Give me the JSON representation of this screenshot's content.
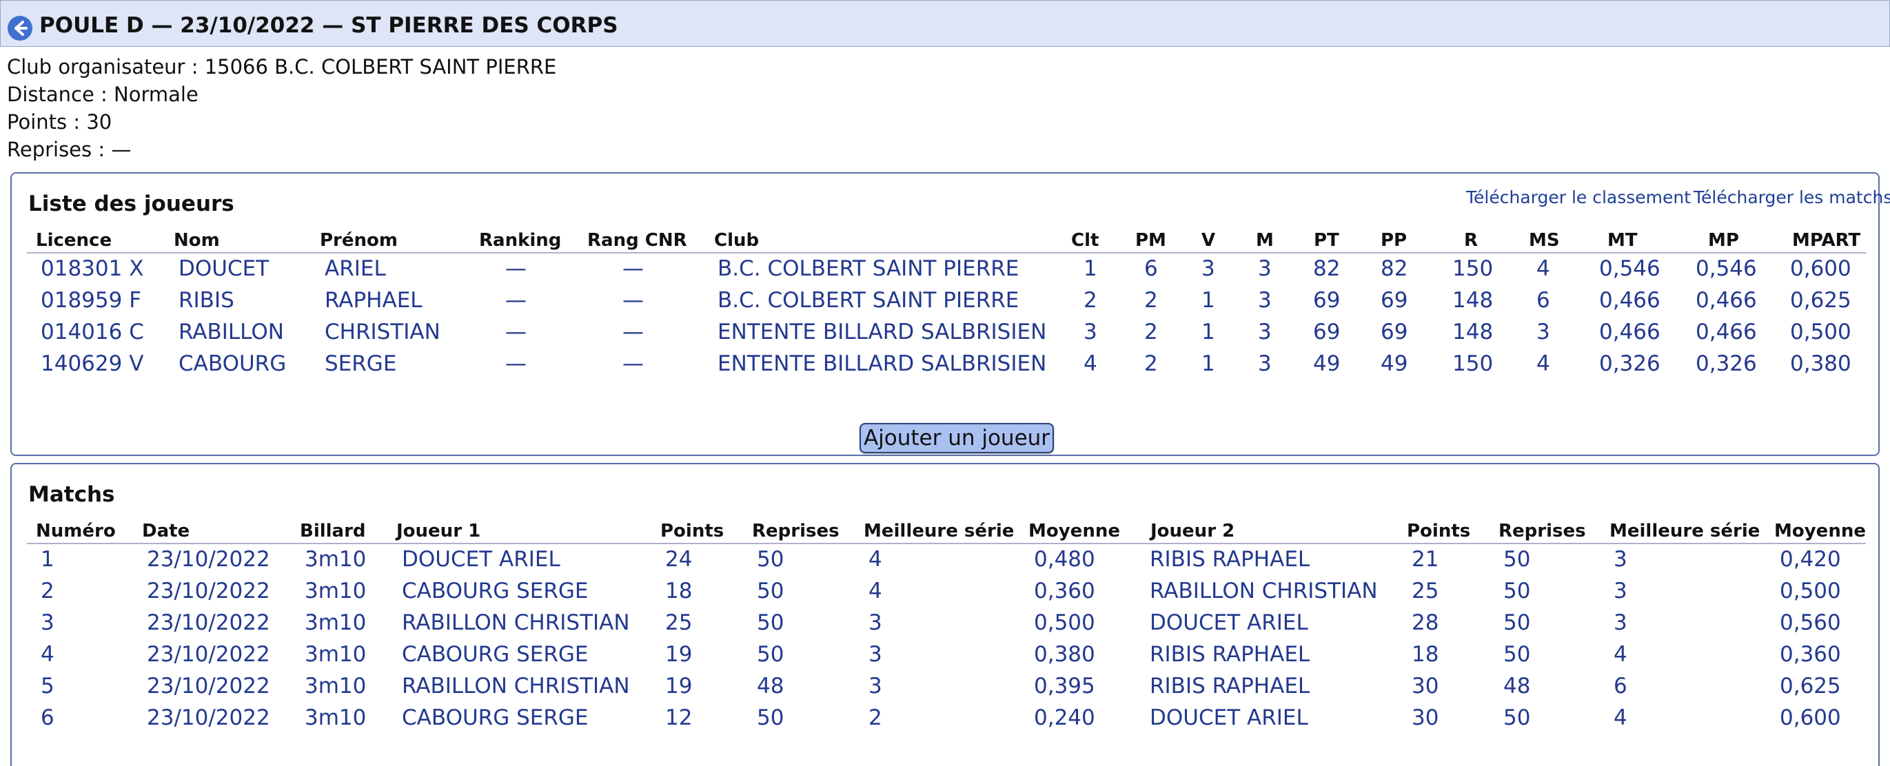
{
  "header": {
    "title": "POULE D — 23/10/2022 — ST PIERRE DES CORPS",
    "back_icon": "circle-arrow-left-icon",
    "accent_color": "#dde5f7"
  },
  "info": [
    {
      "label": "Club organisateur : ",
      "value": "15066 B.C. COLBERT SAINT PIERRE"
    },
    {
      "label": "Distance : ",
      "value": "Normale"
    },
    {
      "label": "Points : ",
      "value": "30"
    },
    {
      "label": "Reprises : ",
      "value": "—"
    }
  ],
  "players": {
    "title": "Liste des joueurs",
    "link_ranking": "Télécharger le classement",
    "link_matches": "Télécharger les matchs",
    "columns": [
      "Licence",
      "Nom",
      "Prénom",
      "Ranking",
      "Rang CNR",
      "Club",
      "Clt",
      "PM",
      "V",
      "M",
      "PT",
      "PP",
      "R",
      "MS",
      "MT",
      "MP",
      "MPART"
    ],
    "rows": [
      [
        "018301 X",
        "DOUCET",
        "ARIEL",
        "—",
        "—",
        "B.C. COLBERT SAINT PIERRE",
        "1",
        "6",
        "3",
        "3",
        "82",
        "82",
        "150",
        "4",
        "0,546",
        "0,546",
        "0,600"
      ],
      [
        "018959 F",
        "RIBIS",
        "RAPHAEL",
        "—",
        "—",
        "B.C. COLBERT SAINT PIERRE",
        "2",
        "2",
        "1",
        "3",
        "69",
        "69",
        "148",
        "6",
        "0,466",
        "0,466",
        "0,625"
      ],
      [
        "014016 C",
        "RABILLON",
        "CHRISTIAN",
        "—",
        "—",
        "ENTENTE BILLARD SALBRISIEN",
        "3",
        "2",
        "1",
        "3",
        "69",
        "69",
        "148",
        "3",
        "0,466",
        "0,466",
        "0,500"
      ],
      [
        "140629 V",
        "CABOURG",
        "SERGE",
        "—",
        "—",
        "ENTENTE BILLARD SALBRISIEN",
        "4",
        "2",
        "1",
        "3",
        "49",
        "49",
        "150",
        "4",
        "0,326",
        "0,326",
        "0,380"
      ]
    ],
    "add_button": "Ajouter un joueur"
  },
  "matches": {
    "title": "Matchs",
    "columns": [
      "Numéro",
      "Date",
      "Billard",
      "Joueur 1",
      "Points",
      "Reprises",
      "Meilleure série",
      "Moyenne",
      "Joueur 2",
      "Points",
      "Reprises",
      "Meilleure série",
      "Moyenne"
    ],
    "rows": [
      [
        "1",
        "23/10/2022",
        "3m10",
        "DOUCET ARIEL",
        "24",
        "50",
        "4",
        "0,480",
        "RIBIS RAPHAEL",
        "21",
        "50",
        "3",
        "0,420"
      ],
      [
        "2",
        "23/10/2022",
        "3m10",
        "CABOURG SERGE",
        "18",
        "50",
        "4",
        "0,360",
        "RABILLON CHRISTIAN",
        "25",
        "50",
        "3",
        "0,500"
      ],
      [
        "3",
        "23/10/2022",
        "3m10",
        "RABILLON CHRISTIAN",
        "25",
        "50",
        "3",
        "0,500",
        "DOUCET ARIEL",
        "28",
        "50",
        "3",
        "0,560"
      ],
      [
        "4",
        "23/10/2022",
        "3m10",
        "CABOURG SERGE",
        "19",
        "50",
        "3",
        "0,380",
        "RIBIS RAPHAEL",
        "18",
        "50",
        "4",
        "0,360"
      ],
      [
        "5",
        "23/10/2022",
        "3m10",
        "RABILLON CHRISTIAN",
        "19",
        "48",
        "3",
        "0,395",
        "RIBIS RAPHAEL",
        "30",
        "48",
        "6",
        "0,625"
      ],
      [
        "6",
        "23/10/2022",
        "3m10",
        "CABOURG SERGE",
        "12",
        "50",
        "2",
        "0,240",
        "DOUCET ARIEL",
        "30",
        "50",
        "4",
        "0,600"
      ]
    ]
  }
}
